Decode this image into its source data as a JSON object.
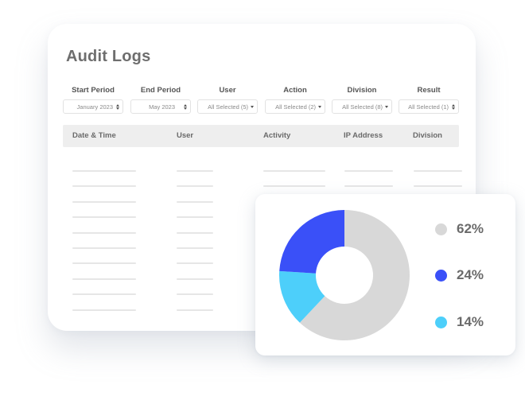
{
  "audit_logs": {
    "title": "Audit Logs",
    "filters": [
      {
        "label": "Start Period",
        "value": "January 2023",
        "control": "stepper"
      },
      {
        "label": "End Period",
        "value": "May 2023",
        "control": "stepper"
      },
      {
        "label": "User",
        "value": "All Selected (5)",
        "control": "dropdown"
      },
      {
        "label": "Action",
        "value": "All Selected (2)",
        "control": "dropdown"
      },
      {
        "label": "Division",
        "value": "All Selected (8)",
        "control": "dropdown"
      },
      {
        "label": "Result",
        "value": "All Selected (1)",
        "control": "stepper"
      }
    ],
    "table": {
      "columns": [
        "Date & Time",
        "User",
        "Activity",
        "IP Address",
        "Division"
      ],
      "placeholder_row_count": 10
    }
  },
  "chart_data": {
    "type": "pie",
    "variant": "donut",
    "title": "",
    "start_angle": "12 o'clock, clockwise",
    "slices": [
      {
        "label": "62%",
        "value": 62,
        "color": "#D8D8D8"
      },
      {
        "label": "14%",
        "value": 14,
        "color": "#4DCFFA"
      },
      {
        "label": "24%",
        "value": 24,
        "color": "#3A50F8"
      }
    ],
    "legend": [
      {
        "label": "62%",
        "color": "#D8D8D8"
      },
      {
        "label": "24%",
        "color": "#3A50F8"
      },
      {
        "label": "14%",
        "color": "#4DCFFA"
      }
    ],
    "legend_position": "right"
  }
}
